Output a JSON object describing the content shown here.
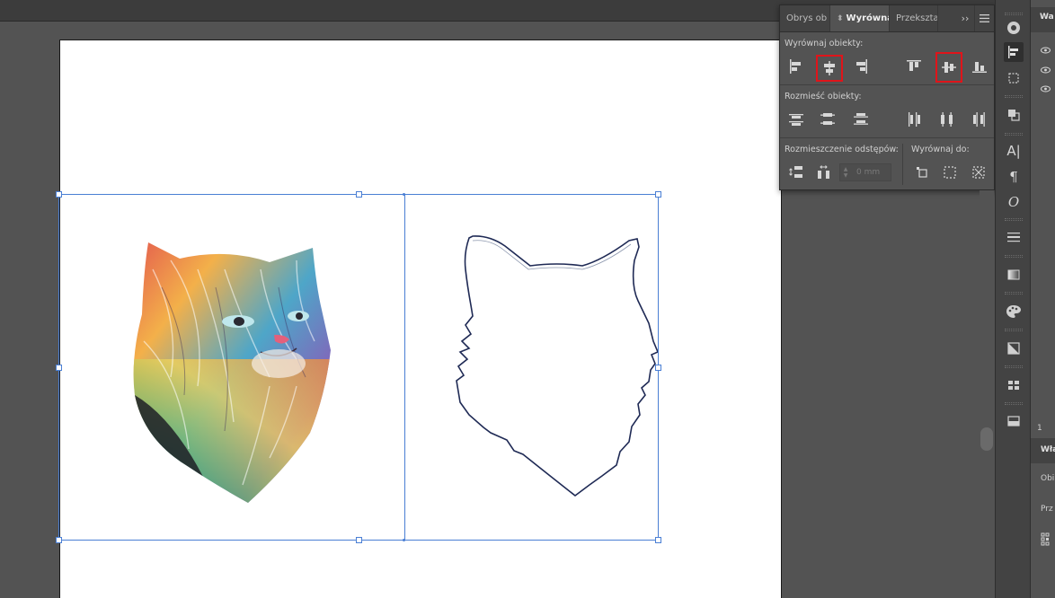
{
  "align_panel": {
    "tabs": [
      {
        "label": "Obrys ob"
      },
      {
        "label": "Wyrównaj"
      },
      {
        "label": "Przeksztа"
      }
    ],
    "sections": {
      "align_objects": "Wyrównaj obiekty:",
      "distribute_objects": "Rozmieść obiekty:",
      "distribute_spacing": "Rozmieszczenie odstępów:",
      "align_to": "Wyrównaj do:"
    },
    "spacing_value": "0 mm",
    "highlight_color": "#e0141a"
  },
  "right_panel": {
    "header_text": "Wa",
    "layers_count": "1",
    "properties_header": "Wła",
    "label_1": "Obi",
    "label_2": "Prz"
  },
  "icons": {
    "art": "cat-illustration",
    "outline": "cat-outline-path"
  }
}
